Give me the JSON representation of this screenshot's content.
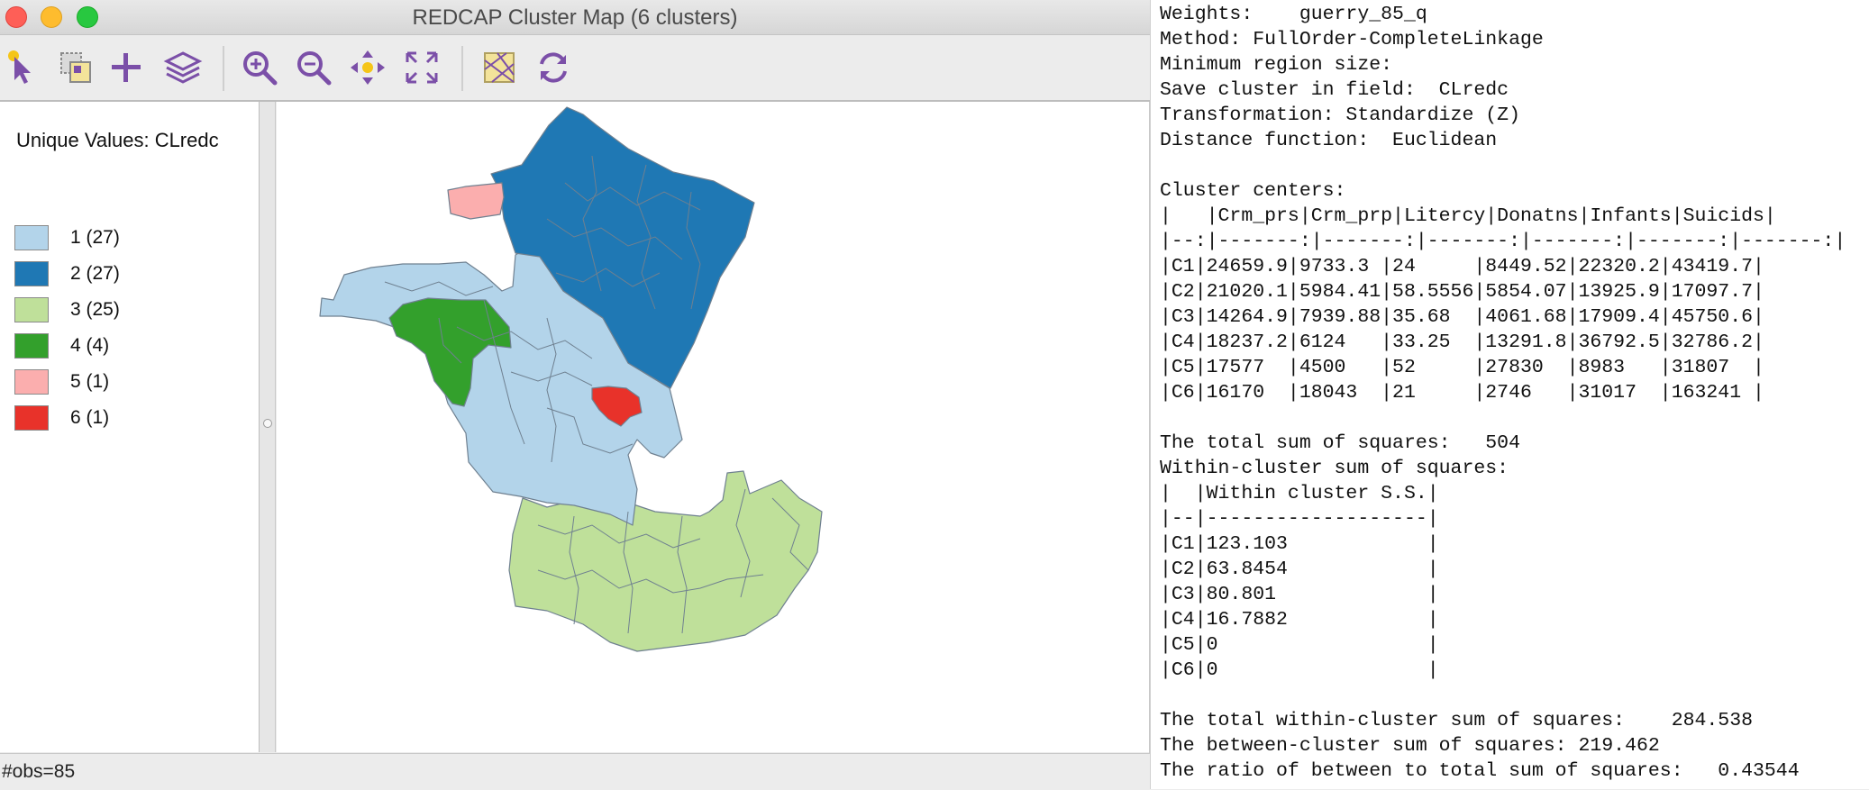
{
  "window": {
    "title": "REDCAP Cluster Map (6 clusters)"
  },
  "toolbar": {
    "buttons": [
      {
        "name": "select-tool",
        "icon": "pointer-icon"
      },
      {
        "name": "selection-tool",
        "icon": "layers-select-icon"
      },
      {
        "name": "add-layer",
        "icon": "plus-icon"
      },
      {
        "name": "layers",
        "icon": "stack-icon"
      },
      {
        "name": "zoom-in",
        "icon": "zoom-in-icon"
      },
      {
        "name": "zoom-out",
        "icon": "zoom-out-icon"
      },
      {
        "name": "pan",
        "icon": "move-icon"
      },
      {
        "name": "fit-extent",
        "icon": "expand-icon"
      },
      {
        "name": "basemap",
        "icon": "basemap-icon"
      },
      {
        "name": "refresh",
        "icon": "refresh-icon"
      }
    ]
  },
  "legend": {
    "title": "Unique Values: CLredc",
    "items": [
      {
        "label": "1 (27)",
        "color": "#b3d4ea"
      },
      {
        "label": "2 (27)",
        "color": "#1f78b4"
      },
      {
        "label": "3 (25)",
        "color": "#bfe09a"
      },
      {
        "label": "4 (4)",
        "color": "#33a02c"
      },
      {
        "label": "5 (1)",
        "color": "#fbaeae"
      },
      {
        "label": "6 (1)",
        "color": "#e8322a"
      }
    ]
  },
  "status": {
    "text": "#obs=85"
  },
  "report": {
    "lines": [
      "Weights:    guerry_85_q",
      "Method: FullOrder-CompleteLinkage",
      "Minimum region size:",
      "Save cluster in field:  CLredc",
      "Transformation: Standardize (Z)",
      "Distance function:  Euclidean",
      "",
      "Cluster centers:",
      "|   |Crm_prs|Crm_prp|Litercy|Donatns|Infants|Suicids|",
      "|--:|-------:|-------:|-------:|-------:|-------:|-------:|",
      "|C1|24659.9|9733.3 |24     |8449.52|22320.2|43419.7|",
      "|C2|21020.1|5984.41|58.5556|5854.07|13925.9|17097.7|",
      "|C3|14264.9|7939.88|35.68  |4061.68|17909.4|45750.6|",
      "|C4|18237.2|6124   |33.25  |13291.8|36792.5|32786.2|",
      "|C5|17577  |4500   |52     |27830  |8983   |31807  |",
      "|C6|16170  |18043  |21     |2746   |31017  |163241 |",
      "",
      "The total sum of squares:   504",
      "Within-cluster sum of squares:",
      "|  |Within cluster S.S.|",
      "|--|-------------------|",
      "|C1|123.103            |",
      "|C2|63.8454            |",
      "|C3|80.801             |",
      "|C4|16.7882            |",
      "|C5|0                  |",
      "|C6|0                  |",
      "",
      "The total within-cluster sum of squares:    284.538",
      "The between-cluster sum of squares: 219.462",
      "The ratio of between to total sum of squares:   0.43544"
    ]
  }
}
